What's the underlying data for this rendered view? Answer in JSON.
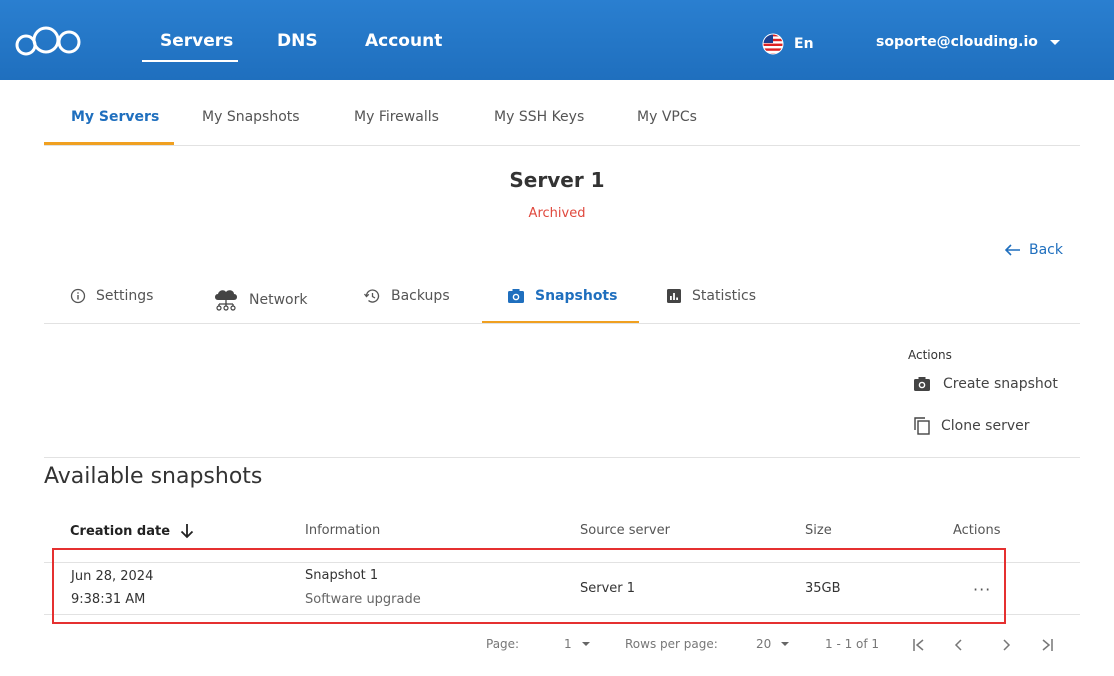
{
  "header": {
    "nav": [
      "Servers",
      "DNS",
      "Account"
    ],
    "language": "En",
    "user_email": "soporte@clouding.io"
  },
  "primary_tabs": [
    "My Servers",
    "My Snapshots",
    "My Firewalls",
    "My SSH Keys",
    "My VPCs"
  ],
  "server": {
    "name": "Server 1",
    "status": "Archived"
  },
  "back_label": "Back",
  "server_tabs": [
    "Settings",
    "Network",
    "Backups",
    "Snapshots",
    "Statistics"
  ],
  "actions": {
    "heading": "Actions",
    "create_snapshot": "Create snapshot",
    "clone_server": "Clone server"
  },
  "snapshots": {
    "title": "Available snapshots",
    "columns": [
      "Creation date",
      "Information",
      "Source server",
      "Size",
      "Actions"
    ],
    "rows": [
      {
        "date": "Jun 28, 2024",
        "time": "9:38:31 AM",
        "name": "Snapshot 1",
        "description": "Software upgrade",
        "source_server": "Server 1",
        "size": "35GB",
        "more": "···"
      }
    ]
  },
  "pagination": {
    "page_label": "Page:",
    "page_value": "1",
    "rows_label": "Rows per page:",
    "rows_value": "20",
    "range": "1 - 1 of 1"
  },
  "colors": {
    "header_blue": "#1f6fbe",
    "accent_orange": "#f0a020",
    "status_red": "#e0483d",
    "highlight_red": "#e53030"
  }
}
